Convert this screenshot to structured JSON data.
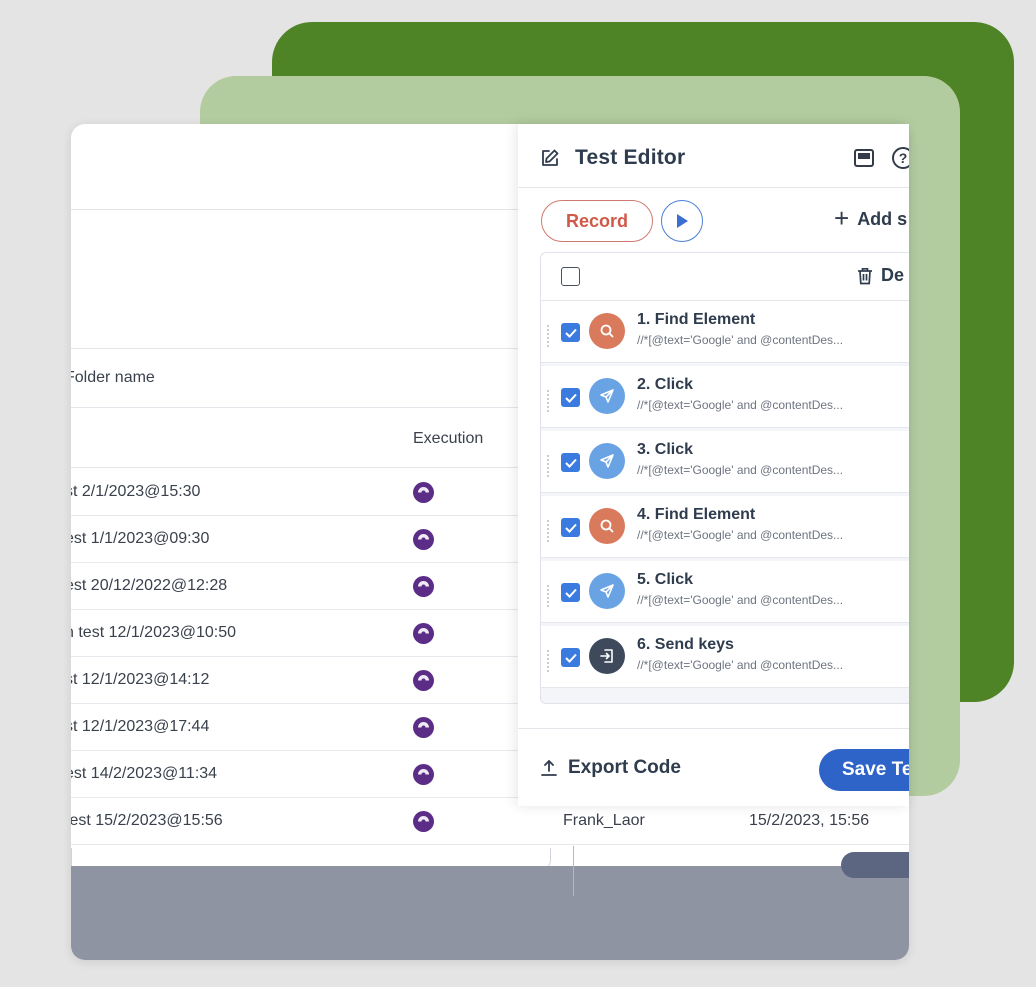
{
  "colors": {
    "background": "#e4e4e4",
    "green_dark": "#4e8326",
    "green_light": "#b3cc9f",
    "accent_blue": "#2e63c8",
    "record_red": "#cf5a48",
    "execution_purple": "#5b2d86"
  },
  "table": {
    "folder_label": "Folder name",
    "execution_header": "Execution",
    "rows": [
      {
        "name": "st 2/1/2023@15:30",
        "execution_icon": "execution-icon"
      },
      {
        "name": "est 1/1/2023@09:30",
        "execution_icon": "execution-icon"
      },
      {
        "name": "est 20/12/2022@12:28",
        "execution_icon": "execution-icon"
      },
      {
        "name": "n test 12/1/2023@10:50",
        "execution_icon": "execution-icon"
      },
      {
        "name": "st 12/1/2023@14:12",
        "execution_icon": "execution-icon"
      },
      {
        "name": "st 12/1/2023@17:44",
        "execution_icon": "execution-icon"
      },
      {
        "name": "est 14/2/2023@11:34",
        "execution_icon": "execution-icon"
      },
      {
        "name": "test 15/2/2023@15:56",
        "execution_icon": "execution-icon",
        "user": "Frank_Laor",
        "date": "15/2/2023, 15:56"
      }
    ]
  },
  "editor": {
    "title": "Test Editor",
    "record_label": "Record",
    "add_step_label": "Add s",
    "delete_label": "De",
    "export_label": "Export Code",
    "save_label": "Save Te",
    "steps": [
      {
        "title": "1. Find  Element",
        "locator": "//*[@text='Google' and @contentDes...",
        "icon": "search-icon",
        "color": "#d97a5c"
      },
      {
        "title": "2. Click",
        "locator": "//*[@text='Google' and @contentDes...",
        "icon": "pointer-icon",
        "color": "#6aa3e3"
      },
      {
        "title": "3. Click",
        "locator": "//*[@text='Google' and @contentDes...",
        "icon": "pointer-icon",
        "color": "#6aa3e3"
      },
      {
        "title": "4. Find  Element",
        "locator": "//*[@text='Google' and @contentDes...",
        "icon": "search-icon",
        "color": "#d97a5c"
      },
      {
        "title": "5. Click",
        "locator": "//*[@text='Google' and @contentDes...",
        "icon": "pointer-icon",
        "color": "#6aa3e3"
      },
      {
        "title": "6. Send keys",
        "locator": "//*[@text='Google' and @contentDes...",
        "icon": "keyboard-input-icon",
        "color": "#3e4a5c"
      }
    ]
  }
}
